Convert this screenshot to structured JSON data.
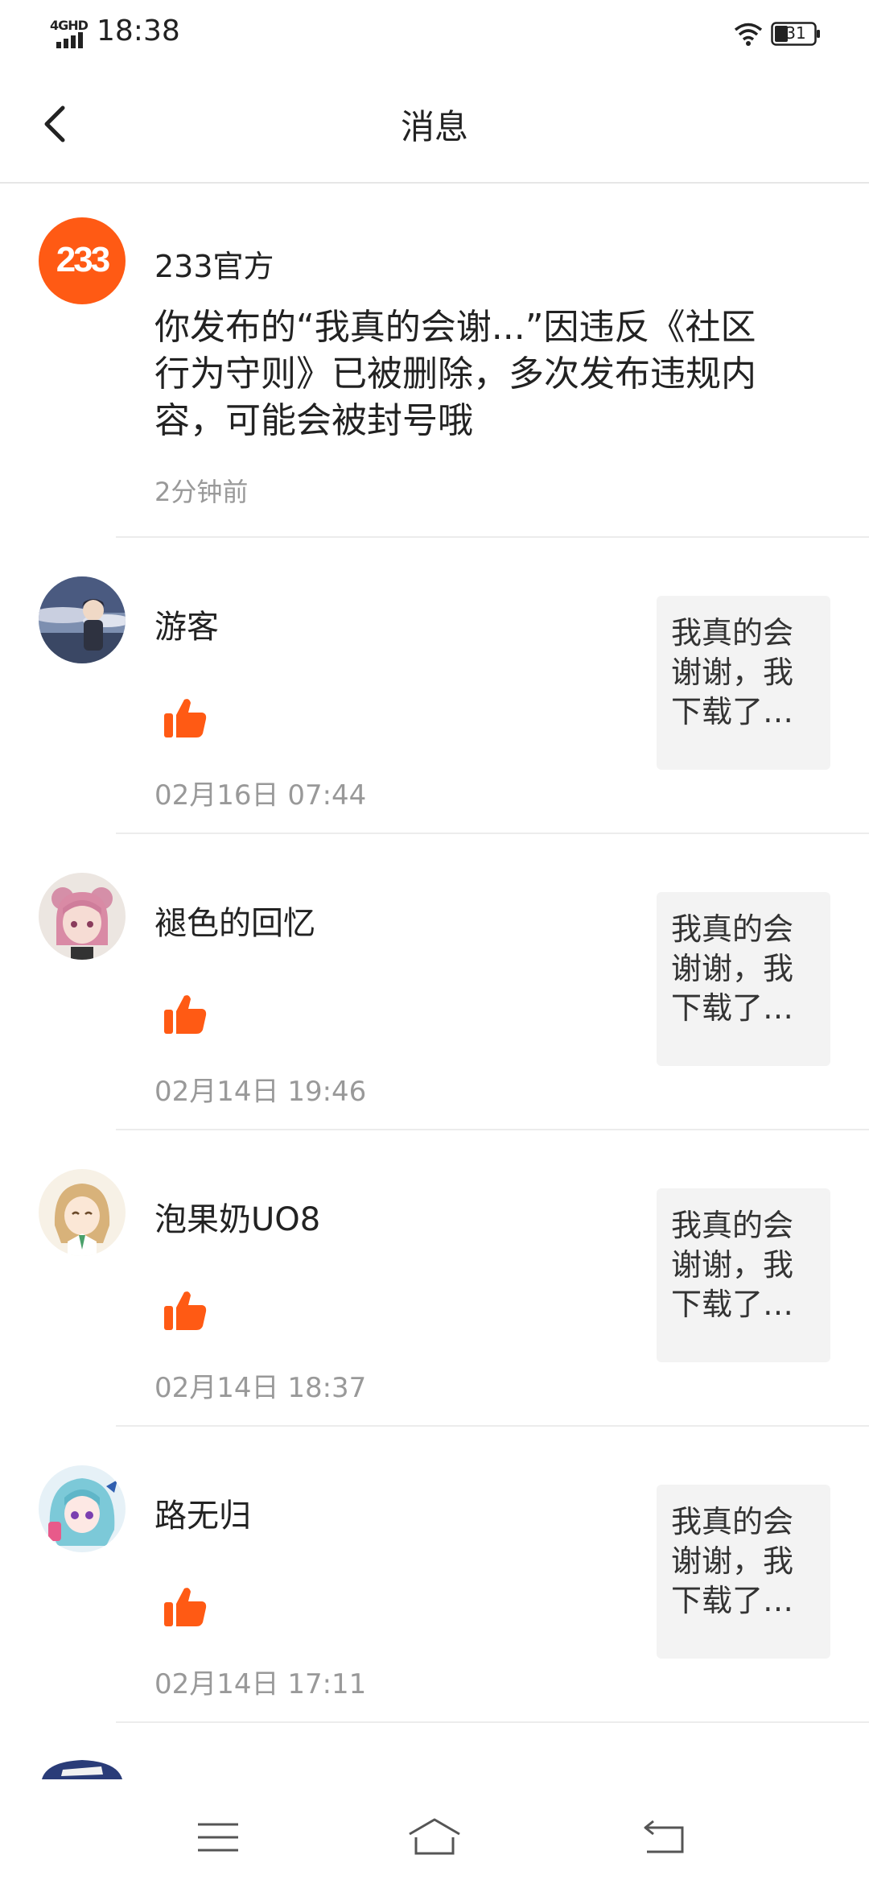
{
  "status_bar": {
    "network": "4GHD",
    "time": "18:38",
    "battery": "31"
  },
  "header": {
    "title": "消息",
    "back_icon": "back-arrow-icon"
  },
  "official": {
    "name": "233官方",
    "avatar_text": "233",
    "message": "你发布的“我真的会谢...”因违反《社区行为守则》已被删除，多次发布违规内容，可能会被封号哦",
    "time": "2分钟前",
    "brand_color": "#FF5A14"
  },
  "notifications": [
    {
      "name": "游客",
      "time": "02月16日 07:44",
      "snippet": "我真的会谢谢，我下载了…",
      "icon": "like-icon"
    },
    {
      "name": "褪色的回忆",
      "time": "02月14日 19:46",
      "snippet": "我真的会谢谢，我下载了…",
      "icon": "like-icon"
    },
    {
      "name": "泡果奶UO8",
      "time": "02月14日 18:37",
      "snippet": "我真的会谢谢，我下载了…",
      "icon": "like-icon"
    },
    {
      "name": "路无归",
      "time": "02月14日 17:11",
      "snippet": "我真的会谢谢，我下载了…",
      "icon": "like-icon"
    }
  ],
  "colors": {
    "accent": "#FF5A14",
    "text": "#222222",
    "secondary_text": "#999999",
    "card_bg": "#F3F3F3"
  },
  "nav_bar": {
    "menu_icon": "menu-icon",
    "home_icon": "home-icon",
    "back_icon": "return-icon"
  }
}
